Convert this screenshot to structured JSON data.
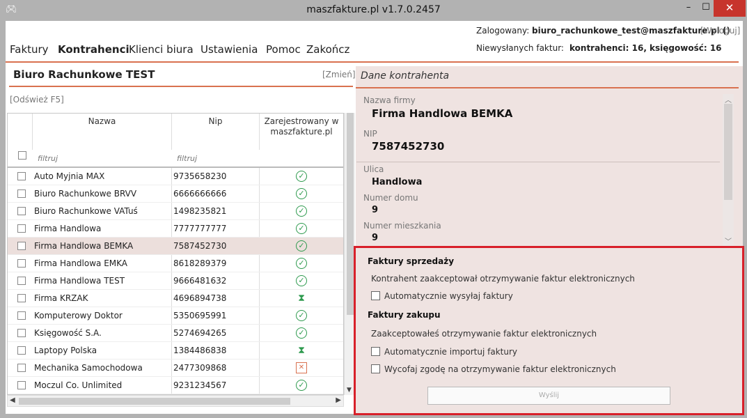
{
  "window": {
    "title": "maszfakture.pl  v1.7.0.2457",
    "icon": "gamepad-icon",
    "minimize": "–",
    "maximize": "☐",
    "close": "✕"
  },
  "header": {
    "login_label": "Zalogowany:",
    "login_user": "biuro_rachunkowe_test@maszfakture.pl ()",
    "logout": "[Wyloguj]",
    "pending_label": "Niewysłanych faktur:",
    "pending_value": "kontrahenci: 16, księgowość: 16"
  },
  "menu": {
    "items": [
      "Faktury",
      "Kontrahenci",
      "Klienci biura",
      "Ustawienia",
      "Pomoc",
      "Zakończ"
    ],
    "active": "Kontrahenci"
  },
  "left": {
    "company": "Biuro Rachunkowe TEST",
    "change": "[Zmień]",
    "refresh": "[Odśwież F5]",
    "columns": {
      "name": "Nazwa",
      "nip": "Nip",
      "registered": "Zarejestrowany w maszfakture.pl"
    },
    "filter_placeholder": "filtruj",
    "rows": [
      {
        "name": "Auto Myjnia MAX",
        "nip": "9735658230",
        "status": "ok"
      },
      {
        "name": "Biuro Rachunkowe BRVV",
        "nip": "6666666666",
        "status": "ok"
      },
      {
        "name": "Biuro Rachunkowe VATuś",
        "nip": "1498235821",
        "status": "ok"
      },
      {
        "name": "Firma Handlowa",
        "nip": "7777777777",
        "status": "ok"
      },
      {
        "name": "Firma Handlowa BEMKA",
        "nip": "7587452730",
        "status": "ok",
        "selected": true
      },
      {
        "name": "Firma Handlowa EMKA",
        "nip": "8618289379",
        "status": "ok"
      },
      {
        "name": "Firma Handlowa TEST",
        "nip": "9666481632",
        "status": "ok"
      },
      {
        "name": "Firma KRZAK",
        "nip": "4696894738",
        "status": "pending"
      },
      {
        "name": "Komputerowy Doktor",
        "nip": "5350695991",
        "status": "ok"
      },
      {
        "name": "Księgowość S.A.",
        "nip": "5274694265",
        "status": "ok"
      },
      {
        "name": "Laptopy Polska",
        "nip": "1384486838",
        "status": "pending"
      },
      {
        "name": "Mechanika Samochodowa",
        "nip": "2477309868",
        "status": "error"
      },
      {
        "name": "Moczul Co. Unlimited",
        "nip": "9231234567",
        "status": "ok"
      }
    ]
  },
  "right": {
    "title": "Dane kontrahenta",
    "fields": {
      "company_label": "Nazwa firmy",
      "company_value": "Firma Handlowa BEMKA",
      "nip_label": "NIP",
      "nip_value": "7587452730",
      "street_label": "Ulica",
      "street_value": "Handlowa",
      "house_label": "Numer domu",
      "house_value": "9",
      "flat_label": "Numer mieszkania",
      "flat_value": "9"
    },
    "sales": {
      "title": "Faktury sprzedaży",
      "text": "Kontrahent zaakceptował otrzymywanie faktur elektronicznych",
      "auto_send": "Automatycznie wysyłaj faktury"
    },
    "purchases": {
      "title": "Faktury zakupu",
      "text": "Zaakceptowałeś otrzymywanie faktur elektronicznych",
      "auto_import": "Automatycznie importuj faktury",
      "withdraw": "Wycofaj zgodę na otrzymywanie faktur elektronicznych"
    },
    "send_button": "Wyślij"
  },
  "colors": {
    "accent": "#d9714f",
    "highlight": "#d8202a",
    "panel": "#efe3e1",
    "ok": "#2e9a4e"
  }
}
